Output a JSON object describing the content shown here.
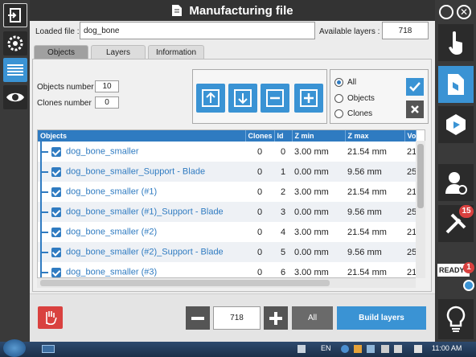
{
  "title": "Manufacturing file",
  "loaded_file_label": "Loaded file :",
  "loaded_file_value": "dog_bone",
  "available_layers_label": "Available layers :",
  "available_layers_value": "718",
  "tabs": [
    "Objects",
    "Layers",
    "Information"
  ],
  "objects_number_label": "Objects number",
  "objects_number_value": "10",
  "clones_number_label": "Clones number",
  "clones_number_value": "0",
  "filter": {
    "all": "All",
    "objects": "Objects",
    "clones": "Clones",
    "selected": "All"
  },
  "table": {
    "headers": [
      "Objects",
      "Clones",
      "Id",
      "Z min",
      "Z max",
      "Vo"
    ],
    "rows": [
      [
        "dog_bone_smaller",
        "0",
        "0",
        "3.00 mm",
        "21.54 mm",
        "21"
      ],
      [
        "dog_bone_smaller_Support - Blade",
        "0",
        "1",
        "0.00 mm",
        "9.56 mm",
        "25"
      ],
      [
        "dog_bone_smaller (#1)",
        "0",
        "2",
        "3.00 mm",
        "21.54 mm",
        "21"
      ],
      [
        "dog_bone_smaller (#1)_Support - Blade",
        "0",
        "3",
        "0.00 mm",
        "9.56 mm",
        "25"
      ],
      [
        "dog_bone_smaller (#2)",
        "0",
        "4",
        "3.00 mm",
        "21.54 mm",
        "21"
      ],
      [
        "dog_bone_smaller (#2)_Support - Blade",
        "0",
        "5",
        "0.00 mm",
        "9.56 mm",
        "25"
      ],
      [
        "dog_bone_smaller (#3)",
        "0",
        "6",
        "3.00 mm",
        "21.54 mm",
        "21"
      ]
    ]
  },
  "footer": {
    "layer_value": "718",
    "all_label": "All",
    "build_label": "Build layers"
  },
  "status": {
    "ready": "READY",
    "ready_count": "1",
    "tools_count": "15"
  },
  "taskbar": {
    "lang": "EN",
    "time": "11:00 AM"
  },
  "colors": {
    "accent": "#3a93d4",
    "header": "#2f7bc1",
    "danger": "#d9413f"
  }
}
